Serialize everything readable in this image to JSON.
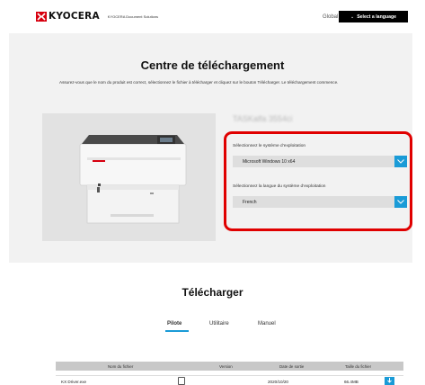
{
  "header": {
    "brand": "KYOCERA",
    "sub_brand": "KYOCERA Document Solutions",
    "global_link": "Global",
    "language_button": "Select a language"
  },
  "main": {
    "title": "Centre de téléchargement",
    "intro": "Assurez-vous que le nom du produit est correct, sélectionnez le fichier à télécharger et cliquez sur le bouton Télécharger. Le téléchargement commence.",
    "product_name": "TASKalfa 3554ci",
    "os_label": "Sélectionnez le système d’exploitation",
    "os_value": "Microsoft Windows 10 x64",
    "lang_label": "Sélectionnez la langue du système d’exploitation",
    "lang_value": "French"
  },
  "download": {
    "title": "Télécharger",
    "tabs": [
      "Pilote",
      "Utilitaire",
      "Manuel"
    ],
    "active_tab": "Pilote",
    "columns": [
      "Nom du fichier",
      "Version",
      "Date de sortie",
      "Taille du fichier"
    ],
    "rows": [
      {
        "name": "KX Driver.exe",
        "version": "",
        "date": "2020/10/20",
        "size": "66.4MB"
      }
    ]
  },
  "colors": {
    "accent": "#1a9bd7",
    "highlight": "#e00000",
    "brand_red": "#d7000f",
    "panel": "#f2f2f2"
  }
}
